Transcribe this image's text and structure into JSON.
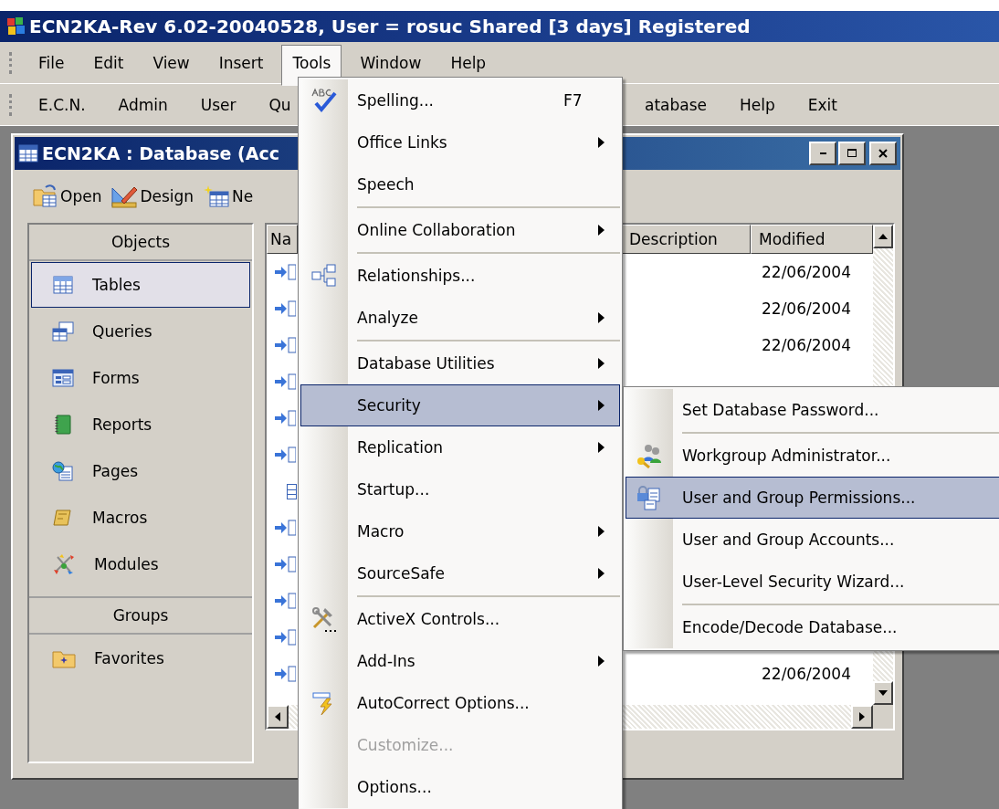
{
  "window": {
    "title": "ECN2KA-Rev 6.02-20040528, User = rosuc Shared [3 days] Registered"
  },
  "menu_bar": [
    {
      "label": "File",
      "selected": false
    },
    {
      "label": "Edit",
      "selected": false
    },
    {
      "label": "View",
      "selected": false
    },
    {
      "label": "Insert",
      "selected": false
    },
    {
      "label": "Tools",
      "selected": true
    },
    {
      "label": "Window",
      "selected": false
    },
    {
      "label": "Help",
      "selected": false
    }
  ],
  "toolbar_left": [
    "E.C.N.",
    "Admin",
    "User",
    "Qu"
  ],
  "toolbar_right": [
    "atabase",
    "Help",
    "Exit"
  ],
  "database_window": {
    "title": "ECN2KA : Database (Acc",
    "toolbar": [
      "Open",
      "Design",
      "Ne"
    ],
    "objects_header": "Objects",
    "objects": [
      {
        "kind": "tables",
        "label": "Tables",
        "selected": true
      },
      {
        "kind": "queries",
        "label": "Queries",
        "selected": false
      },
      {
        "kind": "forms",
        "label": "Forms",
        "selected": false
      },
      {
        "kind": "reports",
        "label": "Reports",
        "selected": false
      },
      {
        "kind": "pages",
        "label": "Pages",
        "selected": false
      },
      {
        "kind": "macros",
        "label": "Macros",
        "selected": false
      },
      {
        "kind": "modules",
        "label": "Modules",
        "selected": false
      }
    ],
    "groups_header": "Groups",
    "groups": [
      {
        "label": "Favorites"
      }
    ],
    "list": {
      "columns": [
        "Na",
        "Description",
        "Modified"
      ],
      "rows": [
        {
          "kind": "linked",
          "modified": "22/06/2004"
        },
        {
          "kind": "linked",
          "modified": "22/06/2004"
        },
        {
          "kind": "linked",
          "modified": "22/06/2004"
        },
        {
          "kind": "linked"
        },
        {
          "kind": "linked"
        },
        {
          "kind": "linked"
        },
        {
          "kind": "local"
        },
        {
          "kind": "linked"
        },
        {
          "kind": "linked"
        },
        {
          "kind": "linked"
        },
        {
          "kind": "linked"
        },
        {
          "kind": "linked",
          "modified": "22/06/2004"
        }
      ]
    }
  },
  "tools_menu": [
    {
      "kind": "item",
      "label": "Spelling...",
      "shortcut": "F7",
      "submenu": false,
      "selected": false,
      "disabled": false
    },
    {
      "kind": "item",
      "label": "Office Links",
      "submenu": true,
      "selected": false,
      "disabled": false
    },
    {
      "kind": "item",
      "label": "Speech",
      "submenu": false,
      "selected": false,
      "disabled": false
    },
    {
      "kind": "separator"
    },
    {
      "kind": "item",
      "label": "Online Collaboration",
      "submenu": true,
      "selected": false,
      "disabled": false
    },
    {
      "kind": "separator"
    },
    {
      "kind": "item",
      "label": "Relationships...",
      "submenu": false,
      "selected": false,
      "disabled": false
    },
    {
      "kind": "item",
      "label": "Analyze",
      "submenu": true,
      "selected": false,
      "disabled": false
    },
    {
      "kind": "separator"
    },
    {
      "kind": "item",
      "label": "Database Utilities",
      "submenu": true,
      "selected": false,
      "disabled": false
    },
    {
      "kind": "item",
      "label": "Security",
      "submenu": true,
      "selected": true,
      "disabled": false
    },
    {
      "kind": "item",
      "label": "Replication",
      "submenu": true,
      "selected": false,
      "disabled": false
    },
    {
      "kind": "item",
      "label": "Startup...",
      "submenu": false,
      "selected": false,
      "disabled": false
    },
    {
      "kind": "item",
      "label": "Macro",
      "submenu": true,
      "selected": false,
      "disabled": false
    },
    {
      "kind": "item",
      "label": "SourceSafe",
      "submenu": true,
      "selected": false,
      "disabled": false
    },
    {
      "kind": "separator"
    },
    {
      "kind": "item",
      "label": "ActiveX Controls...",
      "submenu": false,
      "selected": false,
      "disabled": false
    },
    {
      "kind": "item",
      "label": "Add-Ins",
      "submenu": true,
      "selected": false,
      "disabled": false
    },
    {
      "kind": "item",
      "label": "AutoCorrect Options...",
      "submenu": false,
      "selected": false,
      "disabled": false
    },
    {
      "kind": "item",
      "label": "Customize...",
      "submenu": false,
      "selected": false,
      "disabled": true
    },
    {
      "kind": "item",
      "label": "Options...",
      "submenu": false,
      "selected": false,
      "disabled": false
    }
  ],
  "security_submenu": [
    {
      "kind": "item",
      "label": "Set Database Password...",
      "selected": false
    },
    {
      "kind": "separator"
    },
    {
      "kind": "item",
      "label": "Workgroup Administrator...",
      "selected": false
    },
    {
      "kind": "item",
      "label": "User and Group Permissions...",
      "selected": true
    },
    {
      "kind": "item",
      "label": "User and Group Accounts...",
      "selected": false
    },
    {
      "kind": "item",
      "label": "User-Level Security Wizard...",
      "selected": false
    },
    {
      "kind": "separator"
    },
    {
      "kind": "item",
      "label": "Encode/Decode Database...",
      "selected": false
    }
  ]
}
